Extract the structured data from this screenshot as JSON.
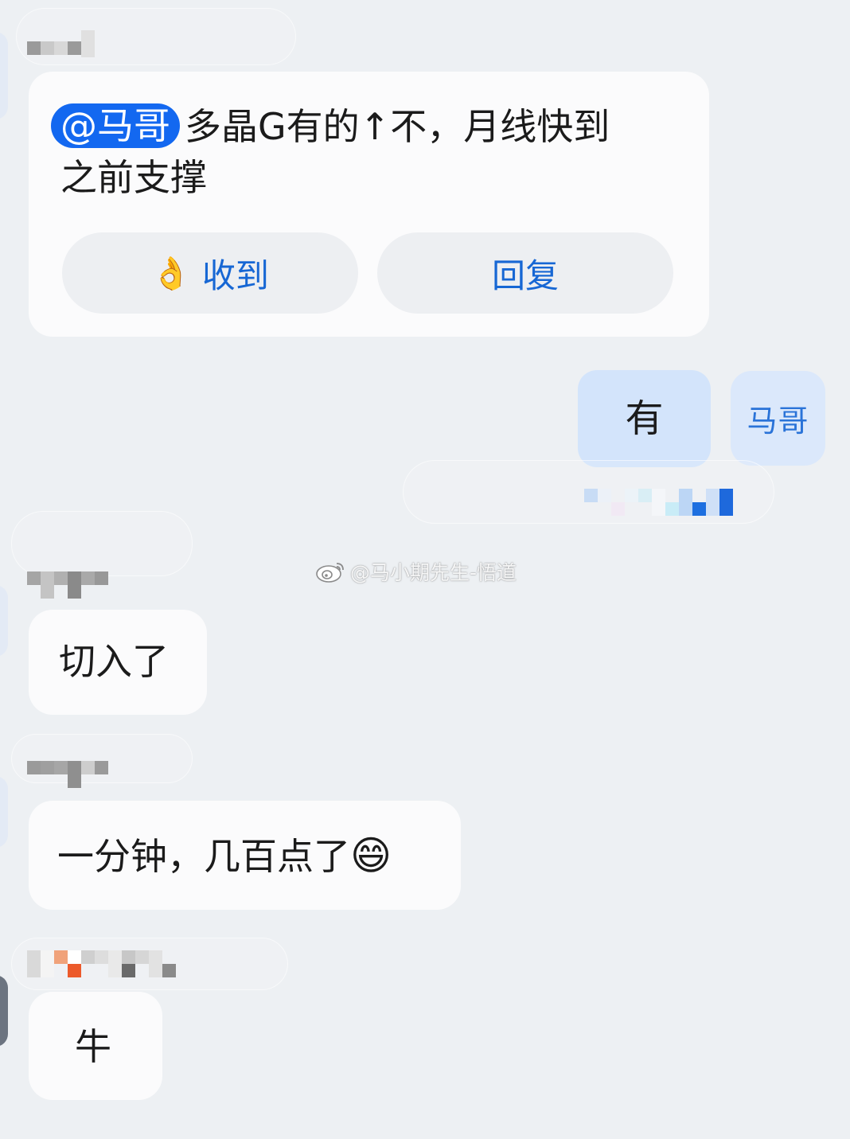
{
  "messages": [
    {
      "mention": "@马哥",
      "text_line1": "多晶G有的↑不，月线快到",
      "text_line2": "之前支撑",
      "actions": {
        "ack_emoji": "👌",
        "ack_label": "收到",
        "reply_label": "回复"
      }
    },
    {
      "text": "有",
      "avatar_text": "马哥"
    },
    {
      "text": "切入了"
    },
    {
      "text": "一分钟，几百点了",
      "emoji": "😄"
    },
    {
      "text": "牛"
    }
  ],
  "watermark": {
    "icon": "weibo-icon",
    "text": "@马小期先生-悟道"
  },
  "colors": {
    "background": "#edf0f3",
    "bubble": "#fbfbfc",
    "self_bubble": "#d3e4fb",
    "mention": "#1368f0",
    "action_text": "#1767d4"
  }
}
